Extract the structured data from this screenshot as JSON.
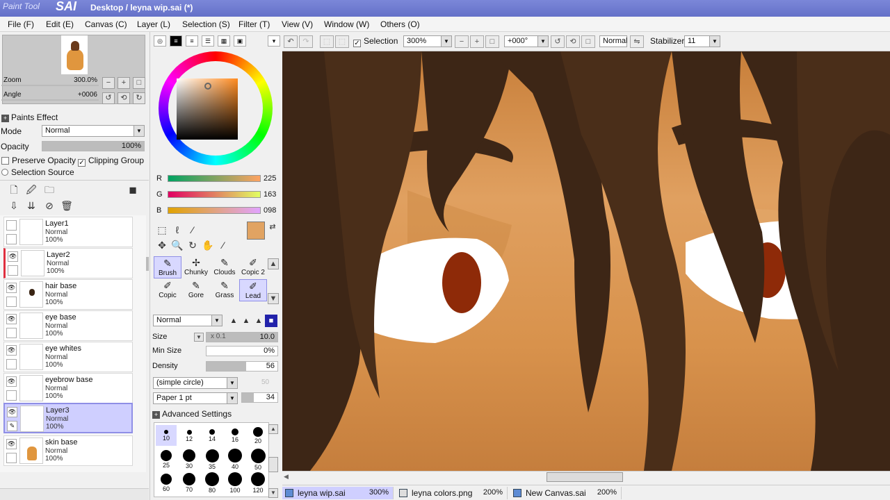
{
  "app": {
    "logo_prefix": "Paint Tool",
    "logo_name": "SAI",
    "window_title": "Desktop / leyna wip.sai (*)"
  },
  "menu": [
    "File (F)",
    "Edit (E)",
    "Canvas (C)",
    "Layer (L)",
    "Selection (S)",
    "Filter (T)",
    "View (V)",
    "Window (W)",
    "Others (O)"
  ],
  "navigator": {
    "zoom_label": "Zoom",
    "zoom_value": "300.0%",
    "angle_label": "Angle",
    "angle_value": "+0006"
  },
  "layer_panel": {
    "paints_effect": "Paints Effect",
    "mode_label": "Mode",
    "mode_value": "Normal",
    "opacity_label": "Opacity",
    "opacity_value": "100%",
    "preserve_opacity": "Preserve Opacity",
    "clipping_group": "Clipping Group",
    "selection_source": "Selection Source",
    "layers": [
      {
        "name": "Layer1",
        "mode": "Normal",
        "opacity": "100%"
      },
      {
        "name": "Layer2",
        "mode": "Normal",
        "opacity": "100%"
      },
      {
        "name": "hair base",
        "mode": "Normal",
        "opacity": "100%"
      },
      {
        "name": "eye base",
        "mode": "Normal",
        "opacity": "100%"
      },
      {
        "name": "eye whites",
        "mode": "Normal",
        "opacity": "100%"
      },
      {
        "name": "eyebrow base",
        "mode": "Normal",
        "opacity": "100%"
      },
      {
        "name": "Layer3",
        "mode": "Normal",
        "opacity": "100%"
      },
      {
        "name": "skin base",
        "mode": "Normal",
        "opacity": "100%"
      }
    ]
  },
  "color": {
    "r_label": "R",
    "r": "225",
    "g_label": "G",
    "g": "163",
    "b_label": "B",
    "b": "098",
    "current": "#e1a362"
  },
  "brushes": {
    "row1": [
      "Brush",
      "Chunky",
      "Clouds",
      "Copic 2"
    ],
    "row2": [
      "Copic",
      "Gore",
      "Grass",
      "Lead"
    ],
    "blend_mode": "Normal",
    "size_label": "Size",
    "size_mult": "x 0.1",
    "size_value": "10.0",
    "min_size_label": "Min Size",
    "min_size_value": "0%",
    "density_label": "Density",
    "density_value": "56",
    "shape": "(simple circle)",
    "shape_value": "50",
    "texture": "Paper 1 pt",
    "texture_value": "34",
    "advanced": "Advanced Settings",
    "dots": [
      "10",
      "12",
      "14",
      "16",
      "20",
      "25",
      "30",
      "35",
      "40",
      "50",
      "60",
      "70",
      "80",
      "100",
      "120"
    ]
  },
  "toolbar": {
    "selection_label": "Selection",
    "zoom": "300%",
    "angle": "+000°",
    "mode": "Normal",
    "stabilizer_label": "Stabilizer",
    "stabilizer_value": "11"
  },
  "documents": [
    {
      "name": "leyna wip.sai",
      "zoom": "300%"
    },
    {
      "name": "leyna colors.png",
      "zoom": "200%"
    },
    {
      "name": "New Canvas.sai",
      "zoom": "200%"
    }
  ]
}
